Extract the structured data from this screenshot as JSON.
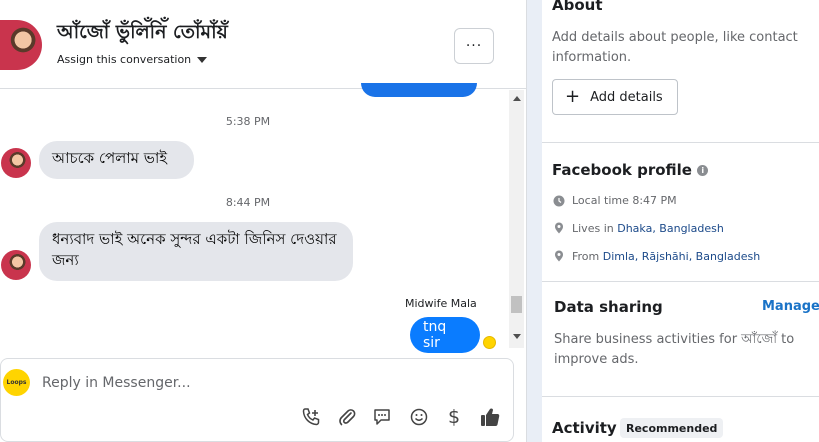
{
  "conversation": {
    "contact_name": "আঁজোঁ ভুঁলিঁনিঁ তোঁমাঁয়ঁ",
    "assign_label": "Assign this conversation",
    "more_label": "···"
  },
  "messages": [
    {
      "type": "timestamp",
      "text": "5:38 PM"
    },
    {
      "type": "incoming",
      "text": "আচকে পেলাম ভাই"
    },
    {
      "type": "timestamp",
      "text": "8:44 PM"
    },
    {
      "type": "incoming",
      "text": "ধন্যবাদ ভাই অনেক সুন্দর একটা জিনিস দেওয়ার জন্য"
    },
    {
      "type": "sender",
      "text": "Midwife Mala"
    },
    {
      "type": "outgoing",
      "text": "tnq sir"
    }
  ],
  "composer": {
    "placeholder": "Reply in Messenger...",
    "avatar_text": "Loops",
    "tools": [
      "add-call-icon",
      "attachment-icon",
      "saved-reply-icon",
      "emoji-icon",
      "dollar-icon",
      "like-icon"
    ]
  },
  "details": {
    "about_title": "About",
    "about_text": "Add details about people, like contact information.",
    "add_details_label": "Add details",
    "fb_profile_title": "Facebook profile",
    "local_time": "Local time 8:47 PM",
    "lives_in_prefix": "Lives in ",
    "lives_in_place": "Dhaka, Bangladesh",
    "from_prefix": "From ",
    "from_place": "Dimla, Rājshāhi, Bangladesh",
    "data_sharing_title": "Data sharing",
    "manage_label": "Manage",
    "data_sharing_text": "Share business activities for আঁজোঁ to improve ads.",
    "activity_title": "Activity",
    "recommended_badge": "Recommended"
  },
  "colors": {
    "outgoing_bubble": "#0a7cff",
    "incoming_bubble": "#e4e6eb",
    "link": "#1a73c7"
  }
}
